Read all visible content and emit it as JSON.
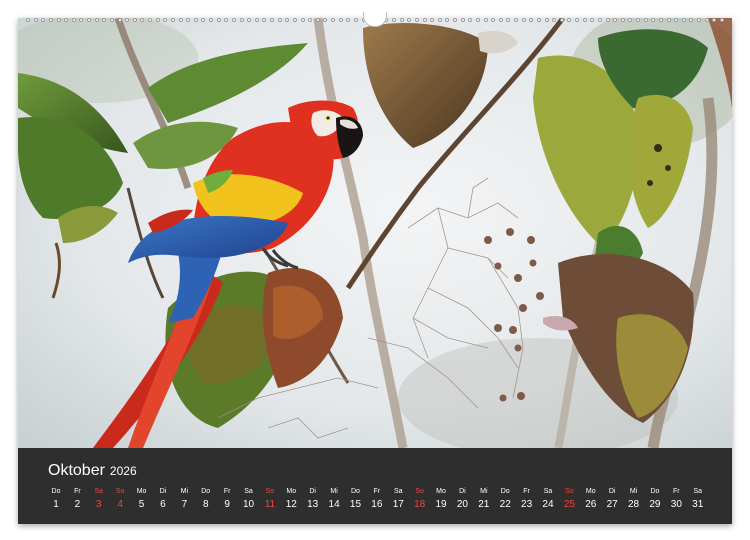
{
  "calendar": {
    "month": "Oktober",
    "year": "2026",
    "days": [
      {
        "wd": "Do",
        "d": "1",
        "red": false
      },
      {
        "wd": "Fr",
        "d": "2",
        "red": false
      },
      {
        "wd": "Sa",
        "d": "3",
        "red": true
      },
      {
        "wd": "So",
        "d": "4",
        "red": true
      },
      {
        "wd": "Mo",
        "d": "5",
        "red": false
      },
      {
        "wd": "Di",
        "d": "6",
        "red": false
      },
      {
        "wd": "Mi",
        "d": "7",
        "red": false
      },
      {
        "wd": "Do",
        "d": "8",
        "red": false
      },
      {
        "wd": "Fr",
        "d": "9",
        "red": false
      },
      {
        "wd": "Sa",
        "d": "10",
        "red": false
      },
      {
        "wd": "So",
        "d": "11",
        "red": true
      },
      {
        "wd": "Mo",
        "d": "12",
        "red": false
      },
      {
        "wd": "Di",
        "d": "13",
        "red": false
      },
      {
        "wd": "Mi",
        "d": "14",
        "red": false
      },
      {
        "wd": "Do",
        "d": "15",
        "red": false
      },
      {
        "wd": "Fr",
        "d": "16",
        "red": false
      },
      {
        "wd": "Sa",
        "d": "17",
        "red": false
      },
      {
        "wd": "So",
        "d": "18",
        "red": true
      },
      {
        "wd": "Mo",
        "d": "19",
        "red": false
      },
      {
        "wd": "Di",
        "d": "20",
        "red": false
      },
      {
        "wd": "Mi",
        "d": "21",
        "red": false
      },
      {
        "wd": "Do",
        "d": "22",
        "red": false
      },
      {
        "wd": "Fr",
        "d": "23",
        "red": false
      },
      {
        "wd": "Sa",
        "d": "24",
        "red": false
      },
      {
        "wd": "So",
        "d": "25",
        "red": true
      },
      {
        "wd": "Mo",
        "d": "26",
        "red": false
      },
      {
        "wd": "Di",
        "d": "27",
        "red": false
      },
      {
        "wd": "Mi",
        "d": "28",
        "red": false
      },
      {
        "wd": "Do",
        "d": "29",
        "red": false
      },
      {
        "wd": "Fr",
        "d": "30",
        "red": false
      },
      {
        "wd": "Sa",
        "d": "31",
        "red": false
      }
    ]
  },
  "colors": {
    "calendar_bg": "#2e2e2e",
    "weekend_red": "#e8473b",
    "parrot_red": "#d8311f",
    "parrot_yellow": "#f2c21d",
    "parrot_blue": "#2b5fb0"
  },
  "photo": {
    "icon": "scarlet-macaw-photo"
  }
}
